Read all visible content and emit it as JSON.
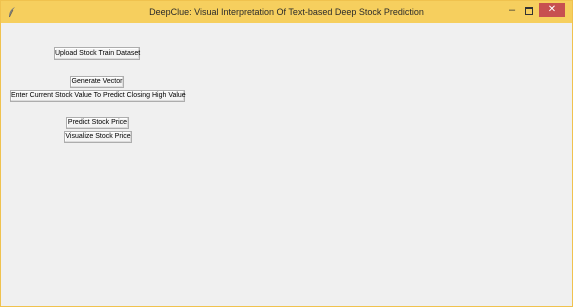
{
  "window": {
    "title": "DeepClue: Visual Interpretation Of Text-based Deep Stock Prediction",
    "title_bar_color": "#f6cf5e",
    "close_color": "#c75050",
    "icons": {
      "app": "feather-icon",
      "minimize": "minimize-icon",
      "maximize": "maximize-icon",
      "close": "close-icon"
    },
    "minimize_glyph": "–",
    "close_glyph": "✕"
  },
  "buttons": {
    "upload": "Upload Stock Train Dataset",
    "vector": "Generate Vector",
    "enter": "Enter Current Stock Value To Predict Closing High Value",
    "predict": "Predict Stock Price",
    "visualize": "Visualize Stock Price"
  }
}
